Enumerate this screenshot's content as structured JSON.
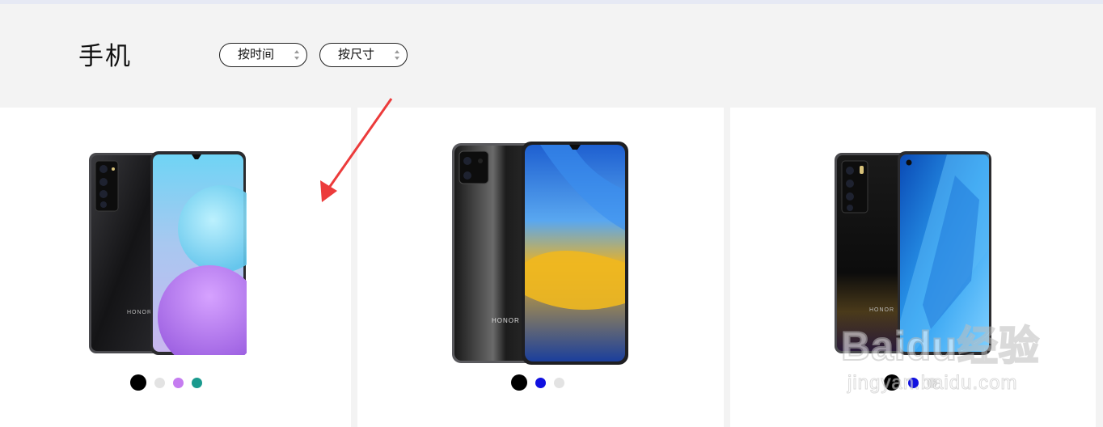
{
  "page": {
    "title": "手机"
  },
  "filters": [
    {
      "label": "按时间"
    },
    {
      "label": "按尺寸"
    }
  ],
  "products": [
    {
      "brand": "HONOR",
      "screen_theme": "pastel bubbles",
      "colors": [
        "#000000",
        "#e3e3e3",
        "#c57cf0",
        "#1a9a8e"
      ],
      "selected_color": 0
    },
    {
      "brand": "HONOR",
      "screen_theme": "blue and gold waves",
      "colors": [
        "#000000",
        "#1010e0",
        "#e3e3e3"
      ],
      "selected_color": 0
    },
    {
      "brand": "HONOR",
      "screen_theme": "blue geometric",
      "colors": [
        "#000000",
        "#1010e0",
        "#e3e3e3"
      ],
      "selected_color": 0
    }
  ],
  "watermark": {
    "text": "Baidu经验",
    "url_text": "jingyan.baidu.com"
  },
  "annotation": {
    "type": "red-arrow",
    "color": "#ec3b3b"
  }
}
